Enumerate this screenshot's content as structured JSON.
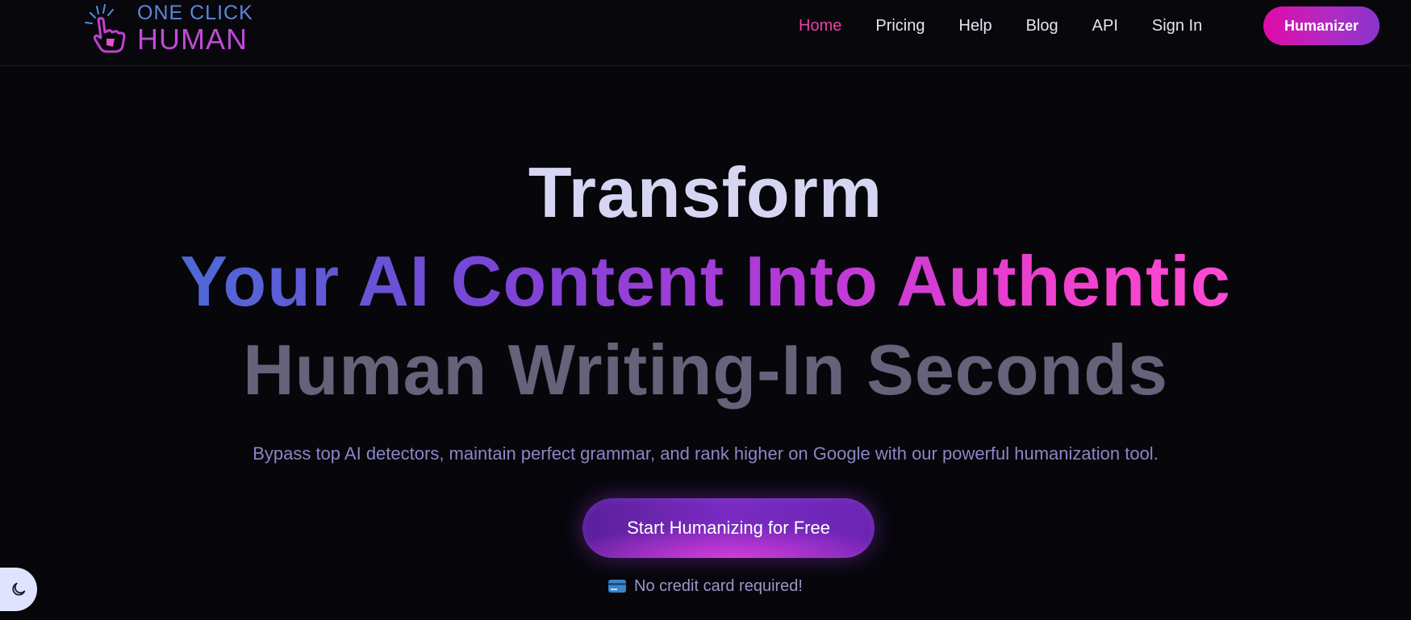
{
  "brand": {
    "line1": "ONE CLICK",
    "line2": "HUMAN"
  },
  "nav": {
    "items": [
      {
        "label": "Home",
        "active": true
      },
      {
        "label": "Pricing",
        "active": false
      },
      {
        "label": "Help",
        "active": false
      },
      {
        "label": "Blog",
        "active": false
      },
      {
        "label": "API",
        "active": false
      },
      {
        "label": "Sign In",
        "active": false
      }
    ],
    "cta_label": "Humanizer"
  },
  "hero": {
    "line1": "Transform",
    "line2": "Your AI Content Into Authentic",
    "line3": "Human Writing-In Seconds",
    "subtitle": "Bypass top AI detectors, maintain perfect grammar, and rank higher on Google with our powerful humanization tool.",
    "cta_label": "Start Humanizing for Free",
    "note": "No credit card required!"
  },
  "icons": {
    "logo": "pointing-hand-logo-icon",
    "note": "credit-card-icon",
    "theme": "moon-icon"
  },
  "colors": {
    "background": "#06060b",
    "accent_pink": "#ef3ea6",
    "gradient_start": "#4d6ad6",
    "gradient_end": "#ff4ad0",
    "muted_heading": "#65637a"
  }
}
